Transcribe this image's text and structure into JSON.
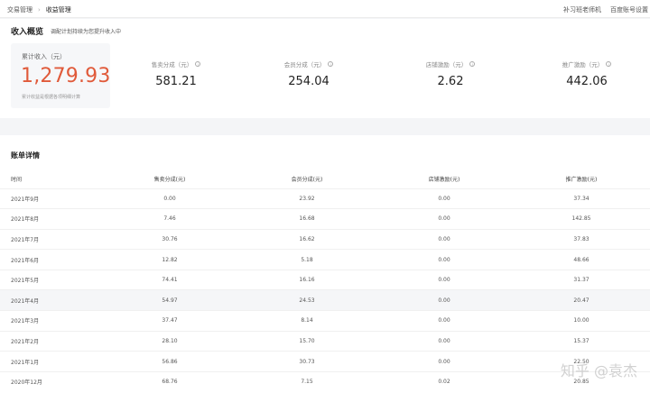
{
  "breadcrumb": {
    "parent": "交易管理",
    "current": "收益管理"
  },
  "top_links": [
    "补习班老师机",
    "百度账号设置"
  ],
  "overview": {
    "title": "收入概览",
    "subtitle": "调配计划持续为您提升收入中",
    "total": {
      "label": "累计收入（元）",
      "value": "1,279.93",
      "note": "累计收益是根据各项明细计算"
    },
    "metrics": [
      {
        "label": "售卖分成（元）",
        "value": "581.21"
      },
      {
        "label": "会员分成（元）",
        "value": "254.04"
      },
      {
        "label": "店铺激励（元）",
        "value": "2.62"
      },
      {
        "label": "推广激励（元）",
        "value": "442.06"
      }
    ]
  },
  "bill": {
    "title": "账单详情",
    "columns": [
      "时间",
      "售卖分成(元)",
      "会员分成(元)",
      "店铺激励(元)",
      "推广激励(元)"
    ],
    "rows": [
      [
        "2021年9月",
        "0.00",
        "23.92",
        "0.00",
        "37.34"
      ],
      [
        "2021年8月",
        "7.46",
        "16.68",
        "0.00",
        "142.85"
      ],
      [
        "2021年7月",
        "30.76",
        "16.62",
        "0.00",
        "37.83"
      ],
      [
        "2021年6月",
        "12.82",
        "5.18",
        "0.00",
        "48.66"
      ],
      [
        "2021年5月",
        "74.41",
        "16.16",
        "0.00",
        "31.37"
      ],
      [
        "2021年4月",
        "54.97",
        "24.53",
        "0.00",
        "20.47"
      ],
      [
        "2021年3月",
        "37.47",
        "8.14",
        "0.00",
        "10.00"
      ],
      [
        "2021年2月",
        "28.10",
        "15.70",
        "0.00",
        "15.37"
      ],
      [
        "2021年1月",
        "56.86",
        "30.73",
        "0.00",
        "22.50"
      ],
      [
        "2020年12月",
        "68.76",
        "7.15",
        "0.02",
        "20.85"
      ]
    ]
  },
  "watermark": "知乎 @袁杰",
  "colors": {
    "accent": "#e05a3a"
  }
}
